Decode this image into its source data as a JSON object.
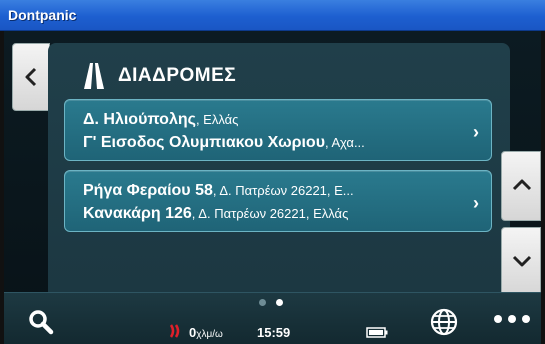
{
  "window": {
    "title": "Dontpanic"
  },
  "panel": {
    "title": "ΔΙΑΔΡΟΜΕΣ",
    "icon": "road-icon"
  },
  "routes": [
    {
      "line1_bold": "Δ. Ηλιούπολης",
      "line1_rest": ", Ελλάς",
      "line2_bold": "Γ' Εισοδος Ολυμπιακου Χωριου",
      "line2_rest": ", Αχα..."
    },
    {
      "line1_bold": "Ρήγα Φεραίου 58",
      "line1_rest": ", Δ. Πατρέων 26221, Ε...",
      "line2_bold": "Κανακάρη 126",
      "line2_rest": ", Δ. Πατρέων 26221, Ελλάς"
    }
  ],
  "status": {
    "speed_value": "0",
    "speed_unit": "χλμ/ω",
    "time": "15:59"
  },
  "pager": {
    "pages": 2,
    "active": 2
  },
  "colors": {
    "titlebar": "#1d5fd0",
    "panel": "#203f4a",
    "card": "#2a7a8e",
    "accent_red": "#e0202a"
  },
  "icons": {
    "back": "chevron-left-icon",
    "up": "chevron-up-icon",
    "down": "chevron-down-icon",
    "search": "search-icon",
    "globe": "globe-icon",
    "more": "more-icon",
    "battery": "battery-icon",
    "speed": "speed-icon"
  }
}
